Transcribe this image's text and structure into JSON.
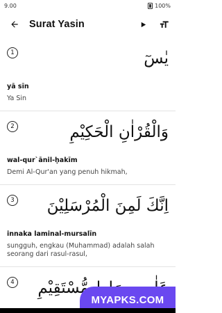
{
  "status": {
    "time": "9.00",
    "battery": "100%"
  },
  "header": {
    "title": "Surat Yasin"
  },
  "icons": {
    "back": "arrow-back-icon",
    "play": "play-icon",
    "text_size": "text-size-icon"
  },
  "verses": [
    {
      "number": "1",
      "arabic": "يٰسٓ",
      "transliteration": "yā sīn",
      "translation": "Ya Sin"
    },
    {
      "number": "2",
      "arabic": "وَالْقُرْاٰنِ الْحَكِيْمِ",
      "transliteration": "wal-qur`ānil-ḥakīm",
      "translation": "Demi Al-Qur'an yang penuh hikmah,"
    },
    {
      "number": "3",
      "arabic": "اِنَّكَ لَمِنَ الْمُرْسَلِيْنَ",
      "transliteration": "innaka laminal-mursalīn",
      "translation": "sungguh, engkau (Muhammad) adalah salah seorang dari rasul-rasul,"
    },
    {
      "number": "4",
      "arabic": "عَلٰى صِرَاطٍ مُّسْتَقِيْمٍ",
      "transliteration": "",
      "translation": ""
    }
  ],
  "watermark": "MYAPKS.COM"
}
